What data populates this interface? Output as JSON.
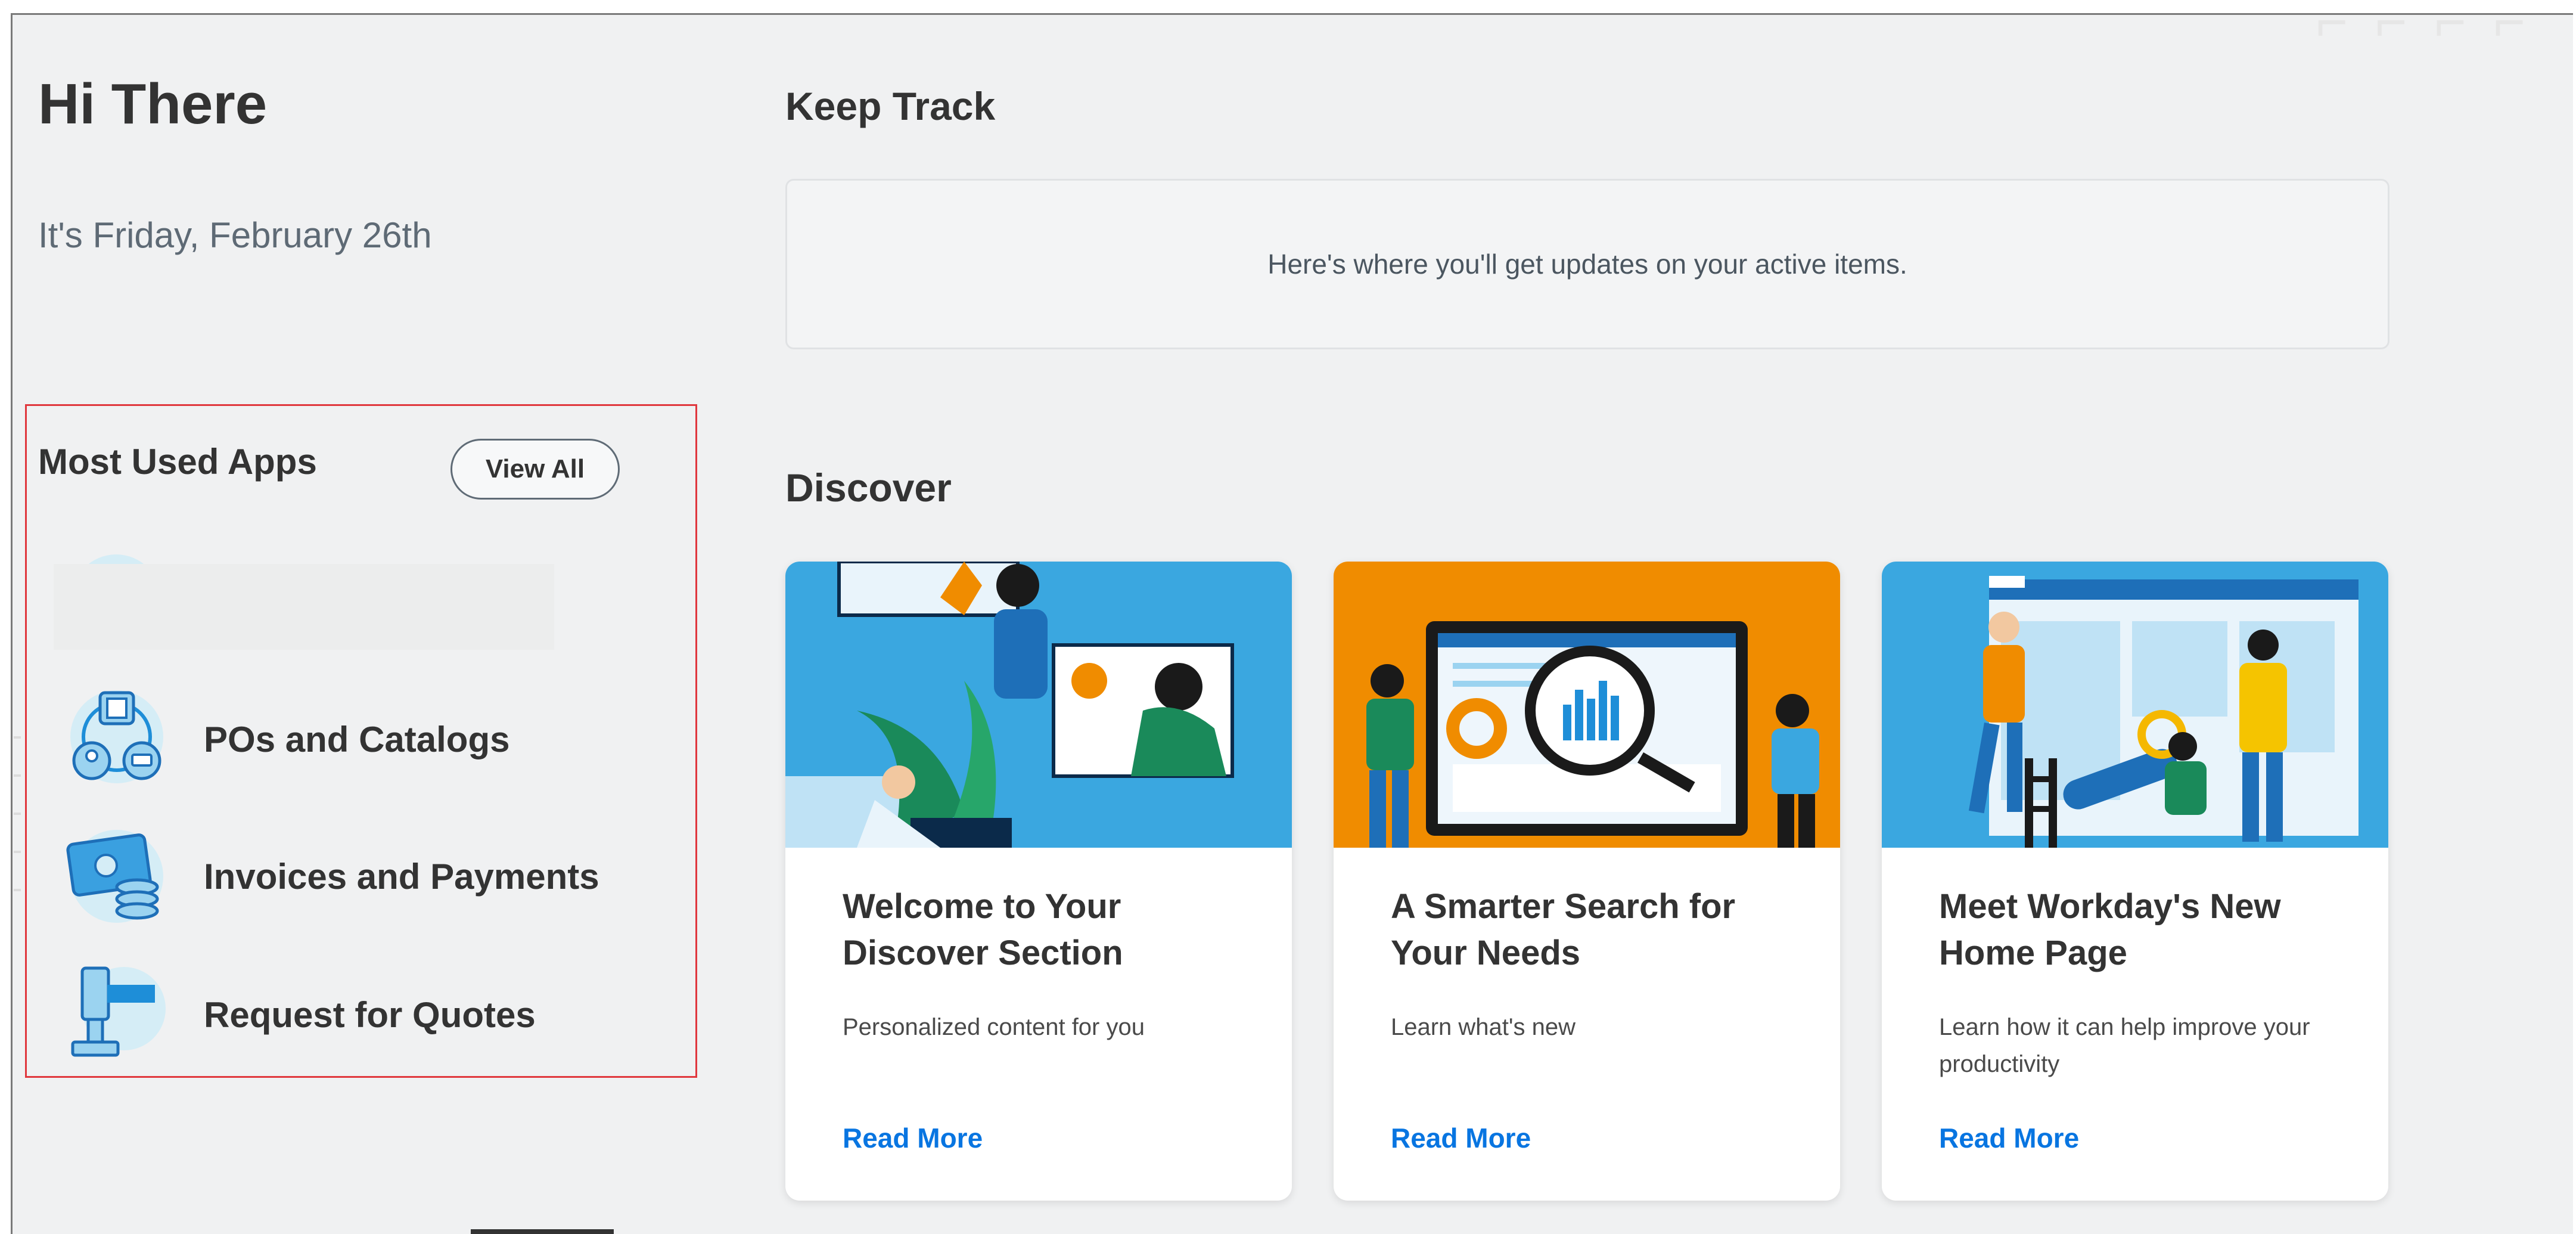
{
  "greeting": "Hi There",
  "date_line": "It's Friday, February 26th",
  "most_used": {
    "title": "Most Used Apps",
    "view_all_label": "View All",
    "apps": [
      {
        "label": "POs and Catalogs",
        "icon": "pos-catalogs-icon"
      },
      {
        "label": "Invoices and Payments",
        "icon": "invoices-payments-icon"
      },
      {
        "label": "Request for Quotes",
        "icon": "request-quotes-icon"
      }
    ]
  },
  "keep_track": {
    "title": "Keep Track",
    "empty_message": "Here's where you'll get updates on your active items."
  },
  "discover": {
    "title": "Discover",
    "cards": [
      {
        "title": "Welcome to Your Discover Section",
        "description": "Personalized content for you",
        "link": "Read More"
      },
      {
        "title": "A Smarter Search for Your Needs",
        "description": "Learn what's new",
        "link": "Read More"
      },
      {
        "title": "Meet Workday's New Home Page",
        "description": "Learn how it can help improve your productivity",
        "link": "Read More"
      }
    ]
  },
  "colors": {
    "background": "#f0f1f2",
    "link": "#0875e1",
    "highlight_border": "#e0383e",
    "card_sky_blue": "#3aa7e0",
    "card_orange": "#f08c00"
  }
}
